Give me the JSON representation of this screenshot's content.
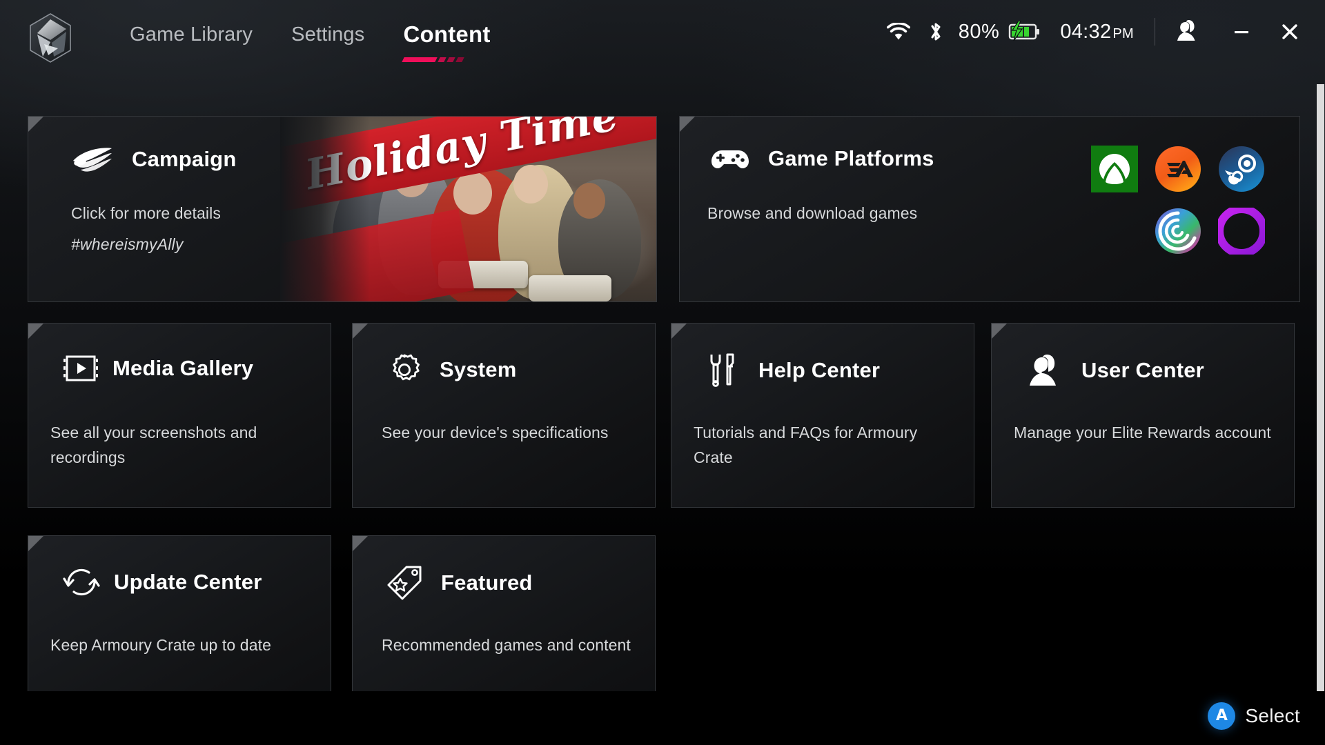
{
  "app": {
    "logo_icon": "rog-hexagon-logo"
  },
  "nav": {
    "tabs": [
      {
        "label": "Game Library",
        "active": false
      },
      {
        "label": "Settings",
        "active": false
      },
      {
        "label": "Content",
        "active": true
      }
    ]
  },
  "status": {
    "wifi_icon": "wifi-icon",
    "bluetooth_icon": "bluetooth-icon",
    "battery_percent": "80%",
    "battery_icon": "battery-charging-icon",
    "battery_color": "#38d430",
    "time": "04:32",
    "ampm": "PM",
    "avatar_icon": "user-avatar-icon",
    "minimize_icon": "minimize-icon",
    "close_icon": "close-icon"
  },
  "cards": {
    "campaign": {
      "title": "Campaign",
      "icon": "rog-eye-logo-icon",
      "desc": "Click for more details",
      "hashtag": "#whereismyAlly",
      "banner_text": "Holiday Time",
      "banner_color": "#c4212a"
    },
    "platforms": {
      "title": "Game Platforms",
      "icon": "gamepad-icon",
      "desc": "Browse and download games",
      "logos": [
        {
          "name": "xbox-logo",
          "color": "#107c10"
        },
        {
          "name": "ea-logo",
          "color": "#ff4d17"
        },
        {
          "name": "steam-logo",
          "color": "#1b6fa8"
        },
        {
          "name": "ubisoft-logo",
          "color": "#7a4fd0"
        },
        {
          "name": "epic-games-logo",
          "color": "#a020f0"
        }
      ]
    },
    "media_gallery": {
      "title": "Media Gallery",
      "icon": "media-play-frame-icon",
      "desc": "See all your screenshots and recordings"
    },
    "system": {
      "title": "System",
      "icon": "gear-icon",
      "desc": "See your device's specifications"
    },
    "help_center": {
      "title": "Help Center",
      "icon": "wrench-screwdriver-icon",
      "desc": "Tutorials and FAQs for Armoury Crate"
    },
    "user_center": {
      "title": "User Center",
      "icon": "user-profile-icon",
      "desc": "Manage your Elite Rewards account"
    },
    "update_center": {
      "title": "Update Center",
      "icon": "refresh-arrows-icon",
      "desc": "Keep Armoury Crate up to date"
    },
    "featured": {
      "title": "Featured",
      "icon": "tag-star-icon",
      "desc": "Recommended games and content"
    }
  },
  "footer": {
    "select_button_glyph": "A",
    "select_label": "Select",
    "button_color": "#1e88e5"
  }
}
